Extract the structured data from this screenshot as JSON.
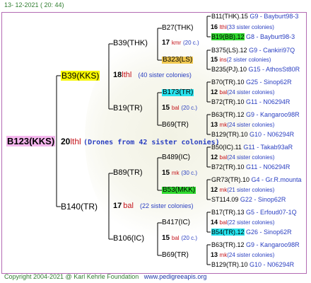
{
  "date": "13- 12-2021 ( 20: 44)",
  "copyright": "Copyright 2004-2021 @ Karl Kehrle Foundation",
  "site": "www.pedigreeapis.org",
  "root": {
    "id": "B123(KKS)",
    "num": "20",
    "line": "lthl",
    "note": "(Drones from 42 sister colonies)"
  },
  "gen1": {
    "top": {
      "id": "B39(KKS)",
      "num": "18",
      "line": "lthl",
      "note": "(40 sister colonies)"
    },
    "bottom": {
      "id": "B140(TR)",
      "num": "17",
      "line": "bal",
      "note": "(22 sister colonies)"
    }
  },
  "gen2": {
    "a": {
      "id": "B39(THK)",
      "num": "17",
      "line": "kmr",
      "note": "(20 c.)"
    },
    "b": {
      "id": "B19(TR)",
      "num": "15",
      "line": "bal",
      "note": "(20 c.)"
    },
    "c": {
      "id": "B89(TR)",
      "num": "15",
      "line": "mk",
      "note": "(30 c.)"
    },
    "d": {
      "id": "B106(IC)",
      "num": "15",
      "line": "bal",
      "note": "(20 c.)"
    }
  },
  "gen3": {
    "a": {
      "id": "B27(THK)",
      "num": "16",
      "line": "lthl",
      "note": "(33 sister colonies)"
    },
    "b": {
      "id": "B323(LS)",
      "num": "15",
      "line": "ins",
      "note": "(2 sister colonies)"
    },
    "c": {
      "id": "B173(TR)",
      "num": "12",
      "line": "bal",
      "note": "(24 sister colonies)"
    },
    "d": {
      "id": "B69(TR)",
      "num": "13",
      "line": "mk",
      "note": "(24 sister colonies)"
    },
    "e": {
      "id": "B489(IC)",
      "num": "12",
      "line": "bal",
      "note": "(24 sister colonies)"
    },
    "f": {
      "id": "B53(MKK)",
      "num": "12",
      "line": "mk",
      "note": "(21 sister colonies)"
    },
    "g": {
      "id": "B417(IC)",
      "num": "14",
      "line": "bal",
      "note": "(22 sister colonies)"
    },
    "h": {
      "id": "B69(TR)",
      "num": "13",
      "line": "mk",
      "note": "(24 sister colonies)"
    }
  },
  "gen4": [
    {
      "id": "B11(THK).15",
      "info": "G9 - Bayburt98-3"
    },
    {
      "id": "B19(BB).12",
      "info": "G8 - Bayburt98-3"
    },
    {
      "id": "B375(LS).12",
      "info": "G9 - Cankiri97Q"
    },
    {
      "id": "B235(PJ).10",
      "info": "G15 - AthosSt80R"
    },
    {
      "id": "B70(TR).10",
      "info": "G25 - Sinop62R"
    },
    {
      "id": "B72(TR).10",
      "info": "G11 - N06294R"
    },
    {
      "id": "B63(TR).12",
      "info": "G9 - Kangaroo98R"
    },
    {
      "id": "B129(TR).10",
      "info": "G10 - N06294R"
    },
    {
      "id": "B50(IC).11",
      "info": "G11 - Takab93aR"
    },
    {
      "id": "B72(TR).10",
      "info": "G11 - N06294R"
    },
    {
      "id": "GR73(TR).10",
      "info": "G4 - Gr.R.mounta"
    },
    {
      "id": "ST114.09",
      "info": "G22 - Sinop62R"
    },
    {
      "id": "B17(TR).13",
      "info": "G5 - Erfoud07-1Q"
    },
    {
      "id": "B54(TR).12",
      "info": "G26 - Sinop62R"
    },
    {
      "id": "B63(TR).12",
      "info": "G9 - Kangaroo98R"
    },
    {
      "id": "B129(TR).10",
      "info": "G10 - N06294R"
    }
  ]
}
